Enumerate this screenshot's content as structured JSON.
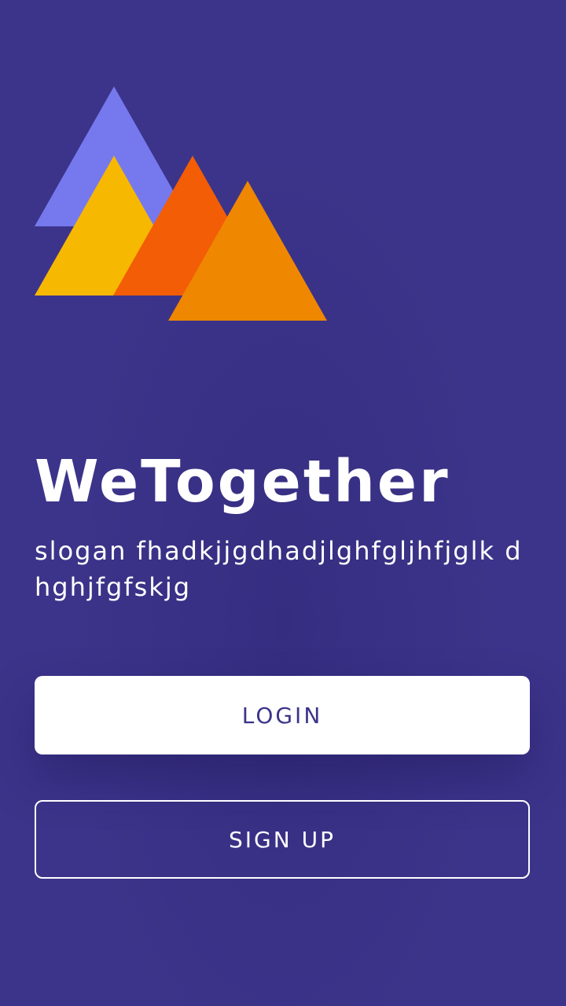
{
  "app": {
    "title": "WeTogether",
    "slogan": "slogan fhadkjjgdhadjlghfgljhfjglk dhghjfgfskjg"
  },
  "logo": {
    "icon": "mountains-logo-icon",
    "colors": {
      "back_triangle": "#7679ee",
      "yellow_triangle": "#f6b800",
      "red_triangle": "#f25d05",
      "orange_triangle": "#ef8700"
    }
  },
  "actions": {
    "login_label": "LOGIN",
    "signup_label": "SIGN UP"
  },
  "colors": {
    "background": "#3c348a",
    "text": "#ffffff",
    "login_text": "#3c348a"
  }
}
